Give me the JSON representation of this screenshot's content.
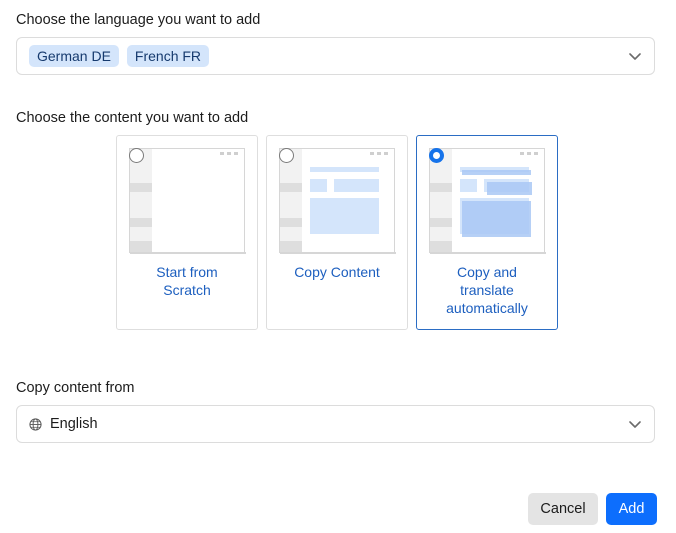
{
  "language_section": {
    "label": "Choose the language you want to add",
    "chips": [
      "German DE",
      "French FR"
    ]
  },
  "content_section": {
    "label": "Choose the content you want to add",
    "options": [
      {
        "label": "Start from Scratch",
        "selected": false
      },
      {
        "label": "Copy Content",
        "selected": false
      },
      {
        "label": "Copy and translate automatically",
        "selected": true
      }
    ]
  },
  "copy_from": {
    "label": "Copy content from",
    "value": "English",
    "icon": "globe-icon"
  },
  "actions": {
    "cancel_label": "Cancel",
    "add_label": "Add"
  },
  "colors": {
    "accent": "#0d6efd",
    "chip_bg": "#d4e5fb",
    "option_text": "#1d5fbf"
  }
}
